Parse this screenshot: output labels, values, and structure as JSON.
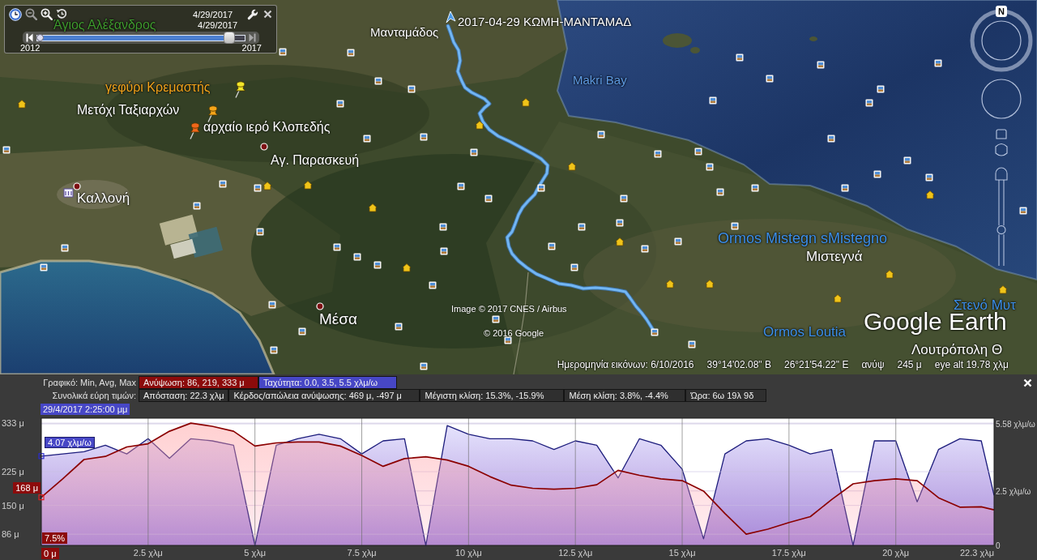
{
  "time_slider": {
    "start_date": "4/29/2017",
    "end_date": "4/29/2017",
    "start_year": "2012",
    "end_year": "2017",
    "level": 0.95
  },
  "map": {
    "labels": [
      {
        "text": "Άγιος Αλέξανδρος",
        "color": "#3f9a2e"
      },
      {
        "text": "2017-04-29 ΚΩΜΗ-ΜΑΝΤΑΜΑΔ",
        "color": "#ffffff"
      },
      {
        "text": "Μανταμάδος",
        "color": "#ffffff"
      },
      {
        "text": "Makri Bay",
        "color": "#5f9de6"
      },
      {
        "text": "γεφύρι Κρεμαστής",
        "color": "#f2a31c"
      },
      {
        "text": "Μετόχι Ταξιαρχών",
        "color": "#ffffff"
      },
      {
        "text": "αρχαίο ιερό Κλοπεδής",
        "color": "#ffffff"
      },
      {
        "text": "Αγ. Παρασκευή",
        "color": "#ffffff"
      },
      {
        "text": "Καλλονή",
        "color": "#ffffff"
      },
      {
        "text": "Ormos Mistegn sMistegno",
        "color": "#3d8fe8"
      },
      {
        "text": "Μιστεγνά",
        "color": "#ffffff"
      },
      {
        "text": "Στενό Μυτ",
        "color": "#3d8fe8"
      },
      {
        "text": "Ormos Loutia",
        "color": "#3d8fe8"
      },
      {
        "text": "Μέσα",
        "color": "#ffffff"
      },
      {
        "text": "Λουτρόπολη Θ",
        "color": "#ffffff"
      }
    ],
    "pushpins": [
      {
        "color": "#f2e62a"
      },
      {
        "color": "#f5a51a"
      },
      {
        "color": "#f0661a"
      }
    ],
    "attribution": [
      "Image © 2017 CNES / Airbus",
      "© 2016 Google"
    ],
    "logo": "Google Earth",
    "status_bar": [
      "Ημερομηνία εικόνων: 6/10/2016",
      "39°14'02.08\" Β",
      "26°21'54.22\" Ε",
      "ανύψ",
      "245 μ",
      "eye alt 19.78 χλμ"
    ]
  },
  "navigation": {
    "north": "N",
    "zoom": {
      "level": 0.41
    }
  },
  "profile": {
    "legend_label": "Γραφικό: Min, Avg, Max",
    "elevation_summary": "Ανύψωση: 86, 219, 333 μ",
    "speed_summary": "Ταχύτητα: 0.0, 3.5, 5.5 χλμ/ω",
    "totals_label": "Συνολικά εύρη τιμών:",
    "totals": [
      "Απόσταση: 22.3 χλμ",
      "Κέρδος/απώλεια ανύψωσης: 469 μ, -497 μ",
      "Μέγιστη κλίση: 15.3%, -15.9%",
      "Μέση κλίση: 3.8%, -4.4%",
      "Ώρα: 6ω 19λ 9δ"
    ],
    "cursor": {
      "time": "29/4/2017 2:25:00 μμ",
      "speed": "4.07 χλμ/ω",
      "elevation": "168 μ",
      "slope": "7.5%",
      "distance": "0 μ"
    },
    "elevation_chart": {
      "chart_data": {
        "type": "area",
        "x": [
          0,
          0.5,
          1,
          1.5,
          2,
          2.5,
          3,
          3.5,
          4,
          4.5,
          5,
          5.5,
          6,
          6.5,
          7,
          7.5,
          8,
          8.5,
          9,
          9.5,
          10,
          10.5,
          11,
          11.5,
          12,
          12.5,
          13,
          13.5,
          14,
          14.5,
          15,
          15.5,
          16,
          16.5,
          17,
          17.5,
          18,
          18.5,
          19,
          19.5,
          20,
          20.5,
          21,
          21.5,
          22,
          22.3
        ],
        "series": [
          {
            "color": "#8b0000",
            "values": [
              168,
              209,
              252,
              259,
              280,
              287,
              315,
              333,
              326,
              315,
              282,
              289,
              291,
              291,
              282,
              261,
              237,
              254,
              258,
              251,
              237,
              214,
              195,
              188,
              186,
              188,
              196,
              228,
              217,
              209,
              205,
              182,
              132,
              86,
              97,
              112,
              125,
              163,
              198,
              205,
              209,
              205,
              167,
              146,
              147,
              140
            ]
          }
        ],
        "xlim": [
          0,
          22.3
        ],
        "ylim": [
          61,
          344
        ],
        "xticks": [
          {
            "value": 2.5,
            "label": "2.5 χλμ"
          },
          {
            "value": 5,
            "label": "5 χλμ"
          },
          {
            "value": 7.5,
            "label": "7.5 χλμ"
          },
          {
            "value": 10,
            "label": "10 χλμ"
          },
          {
            "value": 12.5,
            "label": "12.5 χλμ"
          },
          {
            "value": 15,
            "label": "15 χλμ"
          },
          {
            "value": 17.5,
            "label": "17.5 χλμ"
          },
          {
            "value": 20,
            "label": "20 χλμ"
          },
          {
            "value": 22.3,
            "label": "22.3 χλμ"
          }
        ],
        "yticks": [
          {
            "value": 333,
            "label": "333 μ"
          },
          {
            "value": 225,
            "label": "225 μ"
          },
          {
            "value": 150,
            "label": "150 μ"
          },
          {
            "value": 86,
            "label": "86 μ"
          }
        ],
        "grid": true
      }
    },
    "speed_chart": {
      "chart_data": {
        "type": "area",
        "x": [
          0,
          0.5,
          1,
          1.5,
          2,
          2.5,
          3,
          3.5,
          4,
          4.5,
          5,
          5.5,
          6,
          6.5,
          7,
          7.5,
          8,
          8.5,
          9,
          9.5,
          10,
          10.5,
          11,
          11.5,
          12,
          12.5,
          13,
          13.5,
          14,
          14.5,
          15,
          15.5,
          16,
          16.5,
          17,
          17.5,
          18,
          18.5,
          19,
          19.5,
          20,
          20.5,
          21,
          21.5,
          22,
          22.3
        ],
        "series": [
          {
            "color": "#1c1c7c",
            "values": [
              4.1,
              4.2,
              4.3,
              4.6,
              4.2,
              4.9,
              4.0,
              4.9,
              4.8,
              4.6,
              0,
              4.6,
              4.9,
              5.1,
              4.9,
              4.2,
              4.8,
              4.9,
              0,
              5.5,
              5.1,
              4.9,
              4.9,
              4.8,
              4.4,
              4.8,
              4.6,
              3.1,
              4.9,
              4.6,
              3.5,
              0.3,
              4.2,
              4.8,
              4.9,
              4.6,
              4.2,
              4.4,
              0,
              4.8,
              4.8,
              2.0,
              4.4,
              4.9,
              4.8,
              2.3
            ]
          }
        ],
        "xlim": [
          0,
          22.3
        ],
        "ylim": [
          0,
          5.84
        ],
        "yticks": [
          {
            "value": 5.58,
            "label": "5.58 χλμ/ω"
          },
          {
            "value": 2.5,
            "label": "2.5 χλμ/ω"
          },
          {
            "value": 0,
            "label": "0"
          }
        ],
        "grid": true
      }
    }
  }
}
